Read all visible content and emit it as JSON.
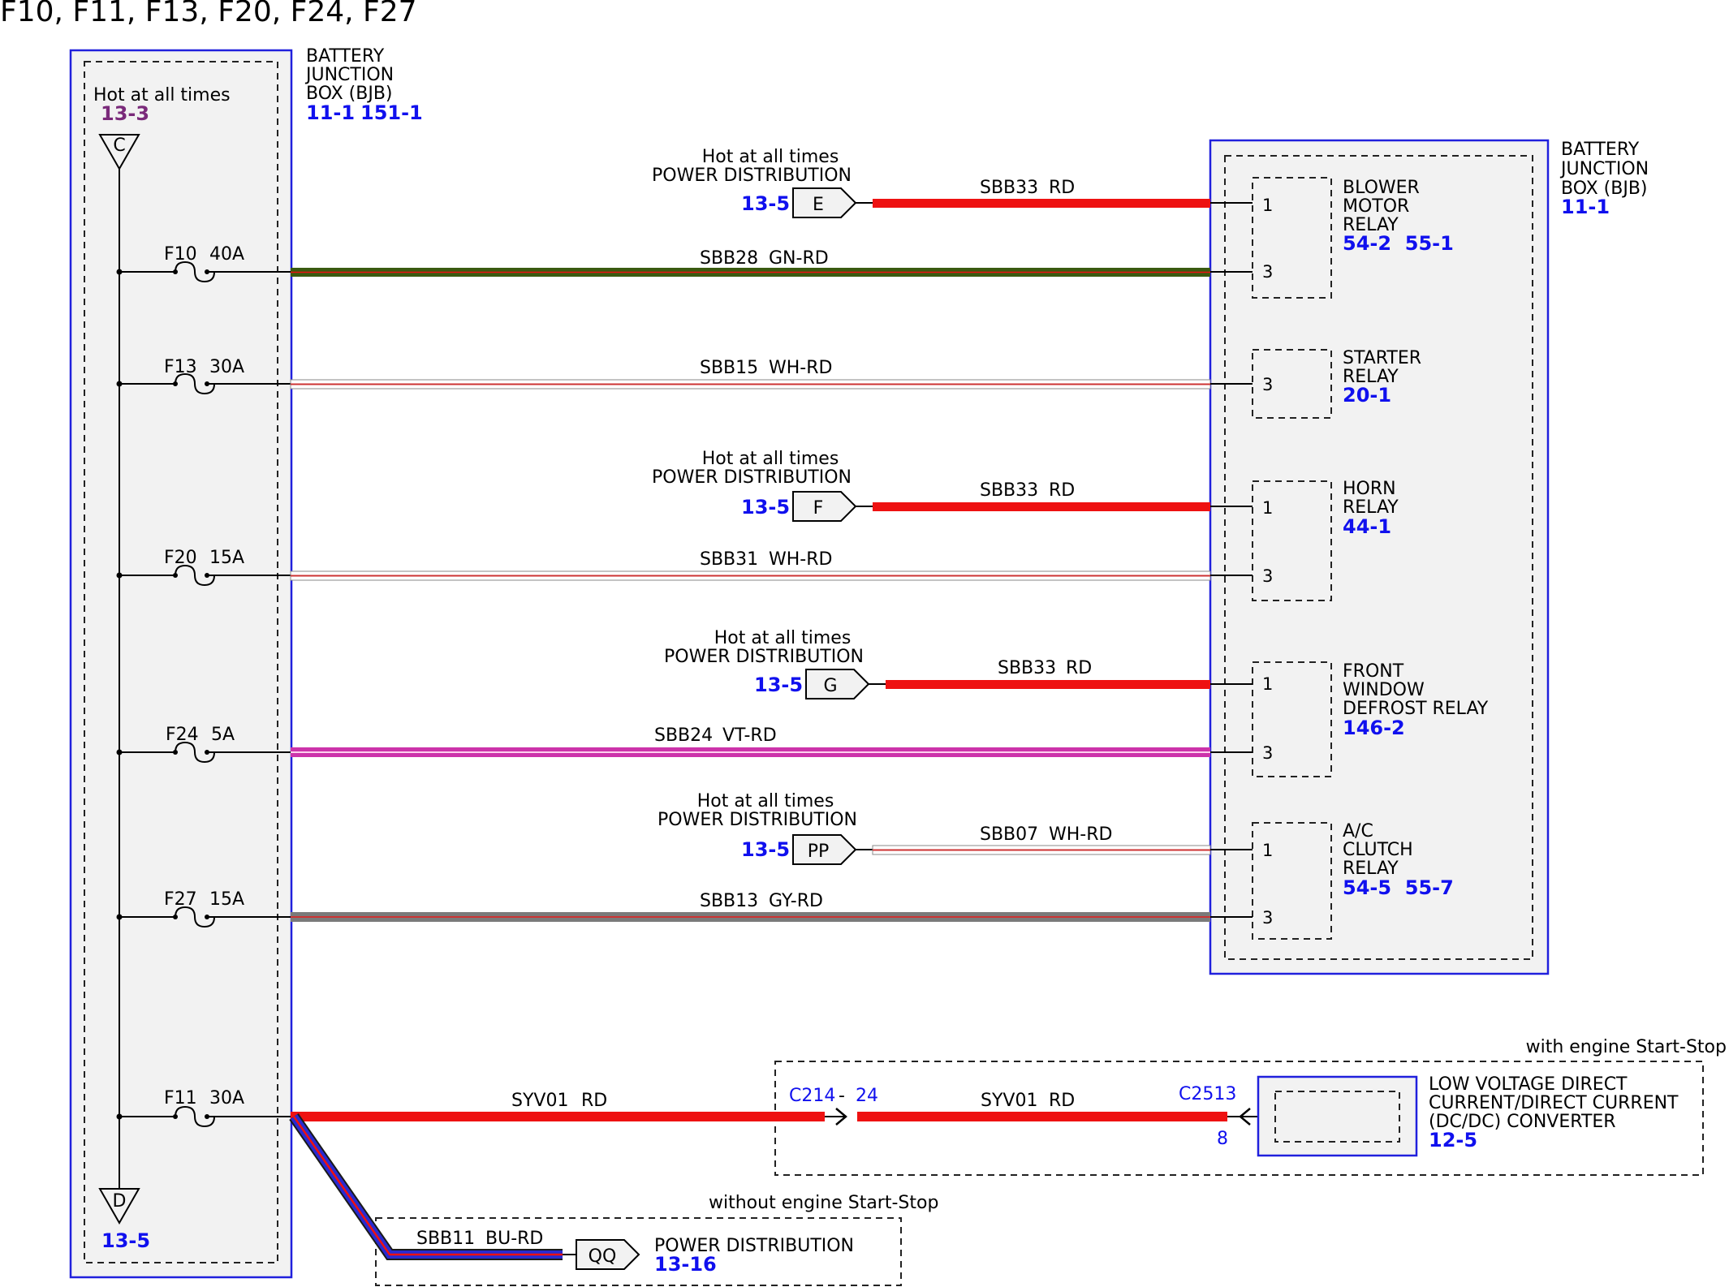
{
  "title": "F10, F11, F13, F20, F24, F27",
  "colors": {
    "box_outline": "#2020dd",
    "box_fill": "#f2f2f2",
    "ref_blue": "#1010ee",
    "ref_purple": "#7a2a7a",
    "wire_rd": "#ee1111",
    "wire_gn": "#3a5a10",
    "wire_wh_stripe": "#cc3333",
    "wire_vt": "#cc33aa",
    "wire_gy": "#7a7a7a",
    "wire_bu": "#2a2ad0"
  },
  "left_box": {
    "name_l1": "BATTERY",
    "name_l2": "JUNCTION",
    "name_l3": "BOX (BJB)",
    "ref1": "11-1",
    "ref2": "151-1",
    "hot_label": "Hot at all times",
    "hot_ref": "13-3",
    "top_connector": "C",
    "bottom_connector": "D",
    "bottom_ref": "13-5"
  },
  "fuses": [
    {
      "id": "F10",
      "rating": "40A"
    },
    {
      "id": "F13",
      "rating": "30A"
    },
    {
      "id": "F20",
      "rating": "15A"
    },
    {
      "id": "F24",
      "rating": "5A"
    },
    {
      "id": "F27",
      "rating": "15A"
    },
    {
      "id": "F11",
      "rating": "30A"
    }
  ],
  "wires": [
    {
      "circuit": "SBB28",
      "color": "GN-RD"
    },
    {
      "circuit": "SBB15",
      "color": "WH-RD"
    },
    {
      "circuit": "SBB31",
      "color": "WH-RD"
    },
    {
      "circuit": "SBB24",
      "color": "VT-RD"
    },
    {
      "circuit": "SBB13",
      "color": "GY-RD"
    }
  ],
  "power_feeds": [
    {
      "hot": "Hot at all times",
      "dist": "POWER DISTRIBUTION",
      "ref": "13-5",
      "connector": "E",
      "circuit": "SBB33",
      "color": "RD"
    },
    {
      "hot": "Hot at all times",
      "dist": "POWER DISTRIBUTION",
      "ref": "13-5",
      "connector": "F",
      "circuit": "SBB33",
      "color": "RD"
    },
    {
      "hot": "Hot at all times",
      "dist": "POWER DISTRIBUTION",
      "ref": "13-5",
      "connector": "G",
      "circuit": "SBB33",
      "color": "RD"
    },
    {
      "hot": "Hot at all times",
      "dist": "POWER DISTRIBUTION",
      "ref": "13-5",
      "connector": "PP",
      "circuit": "SBB07",
      "color": "WH-RD"
    }
  ],
  "right_box": {
    "name_l1": "BATTERY",
    "name_l2": "JUNCTION",
    "name_l3": "BOX (BJB)",
    "ref": "11-1"
  },
  "relays": [
    {
      "lines": [
        "BLOWER",
        "MOTOR",
        "RELAY"
      ],
      "refs": "54-2  55-1",
      "pins": [
        "1",
        "3"
      ]
    },
    {
      "lines": [
        "STARTER",
        "RELAY"
      ],
      "refs": "20-1",
      "pins": [
        "3"
      ]
    },
    {
      "lines": [
        "HORN",
        "RELAY"
      ],
      "refs": "44-1",
      "pins": [
        "1",
        "3"
      ]
    },
    {
      "lines": [
        "FRONT",
        "WINDOW",
        "DEFROST RELAY"
      ],
      "refs": "146-2",
      "pins": [
        "1",
        "3"
      ]
    },
    {
      "lines": [
        "A/C",
        "CLUTCH",
        "RELAY"
      ],
      "refs": "54-5  55-7",
      "pins": [
        "1",
        "3"
      ]
    }
  ],
  "start_stop": {
    "label": "with engine Start-Stop",
    "wire1": {
      "circuit": "SYV01",
      "color": "RD"
    },
    "connector1": "C214",
    "connector1_sep": "-",
    "connector1_pin": "24",
    "wire2": {
      "circuit": "SYV01",
      "color": "RD"
    },
    "connector2": "C2513",
    "connector2_pin": "8",
    "converter_l1": "LOW VOLTAGE DIRECT",
    "converter_l2": "CURRENT/DIRECT CURRENT",
    "converter_l3": "(DC/DC) CONVERTER",
    "converter_ref": "12-5"
  },
  "no_start_stop": {
    "label": "without engine Start-Stop",
    "circuit": "SBB11",
    "color": "BU-RD",
    "connector": "QQ",
    "dest": "POWER DISTRIBUTION",
    "ref": "13-16"
  }
}
